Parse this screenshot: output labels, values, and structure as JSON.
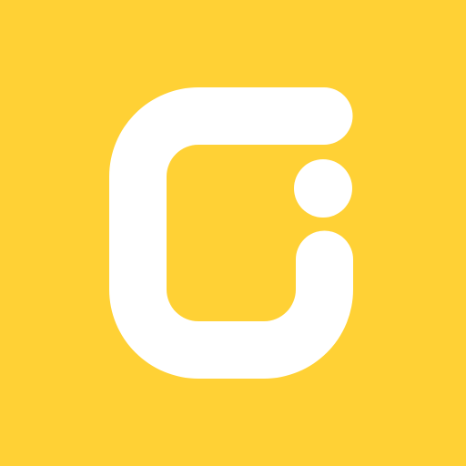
{
  "app_icon": {
    "icon_name": "logo-icon",
    "background_color": "#FFD135",
    "mark_color": "#FFFFFF"
  }
}
